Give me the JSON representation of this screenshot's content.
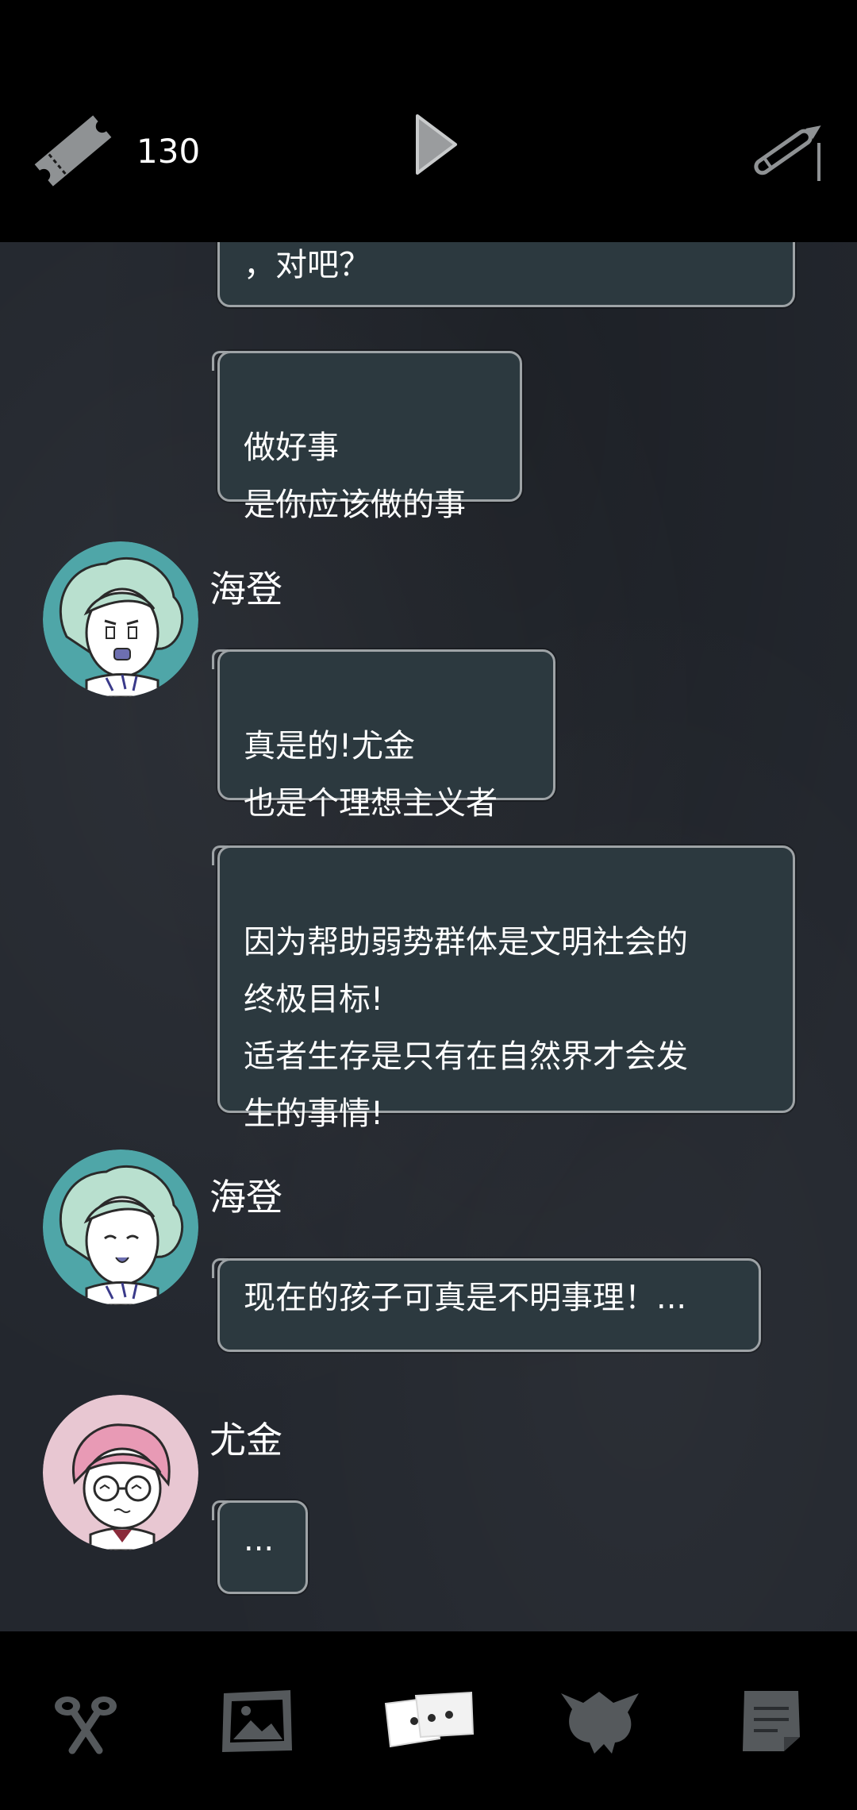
{
  "header": {
    "ticket_icon": "ticket-icon",
    "ticket_count": "130",
    "play_icon": "play-icon",
    "pen_icon": "pen-icon"
  },
  "messages": [
    {
      "text": "，对吧？"
    },
    {
      "text": "做好事\n是你应该做的事"
    },
    {
      "speaker": "海登",
      "text": "真是的!尤金\n也是个理想主义者"
    },
    {
      "text": "因为帮助弱势群体是文明社会的\n终极目标!\n适者生存是只有在自然界才会发\n生的事情!"
    },
    {
      "speaker": "海登",
      "text": "现在的孩子可真是不明事理！..."
    },
    {
      "speaker": "尤金",
      "text": "..."
    }
  ],
  "nav": [
    {
      "name": "scissors-icon"
    },
    {
      "name": "gallery-icon"
    },
    {
      "name": "chat-icon",
      "active": true
    },
    {
      "name": "creature-icon"
    },
    {
      "name": "notes-icon"
    }
  ],
  "colors": {
    "background": "#23272e",
    "bubble": "#2c393f",
    "bubble_border": "#9ea3a6",
    "hayden_avatar_bg": "#4fa6a8",
    "eugene_avatar_bg": "#e8c7d2"
  }
}
